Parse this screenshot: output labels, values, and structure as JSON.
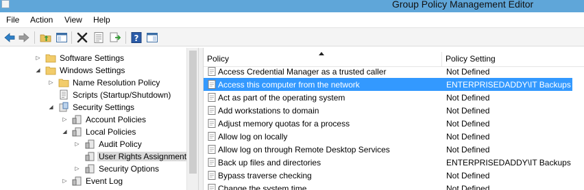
{
  "window": {
    "title": "Group Policy Management Editor"
  },
  "menu": {
    "file": "File",
    "action": "Action",
    "view": "View",
    "help": "Help"
  },
  "toolbar": {
    "icons": [
      "back-arrow-icon",
      "forward-arrow-icon",
      "up-folder-icon",
      "show-hide-tree-icon",
      "delete-icon",
      "properties-icon",
      "export-list-icon",
      "help-icon",
      "show-action-pane-icon"
    ]
  },
  "tree": {
    "items": [
      {
        "label": "Software Settings",
        "expander": "▷",
        "icon": "folder-icon"
      },
      {
        "label": "Windows Settings",
        "expander": "◢",
        "icon": "folder-icon"
      },
      {
        "label": "Name Resolution Policy",
        "expander": "▷",
        "icon": "folder-icon"
      },
      {
        "label": "Scripts (Startup/Shutdown)",
        "expander": "",
        "icon": "script-icon"
      },
      {
        "label": "Security Settings",
        "expander": "◢",
        "icon": "security-settings-icon"
      },
      {
        "label": "Account Policies",
        "expander": "▷",
        "icon": "policy-icon"
      },
      {
        "label": "Local Policies",
        "expander": "◢",
        "icon": "policy-icon"
      },
      {
        "label": "Audit Policy",
        "expander": "▷",
        "icon": "policy-icon"
      },
      {
        "label": "User Rights Assignment",
        "expander": "",
        "icon": "policy-icon"
      },
      {
        "label": "Security Options",
        "expander": "▷",
        "icon": "policy-icon"
      },
      {
        "label": "Event Log",
        "expander": "▷",
        "icon": "policy-icon"
      }
    ]
  },
  "list": {
    "columns": {
      "policy": "Policy",
      "setting": "Policy Setting"
    },
    "rows": [
      {
        "policy": "Access Credential Manager as a trusted caller",
        "setting": "Not Defined"
      },
      {
        "policy": "Access this computer from the network",
        "setting": "ENTERPRISEDADDY\\IT Backups"
      },
      {
        "policy": "Act as part of the operating system",
        "setting": "Not Defined"
      },
      {
        "policy": "Add workstations to domain",
        "setting": "Not Defined"
      },
      {
        "policy": "Adjust memory quotas for a process",
        "setting": "Not Defined"
      },
      {
        "policy": "Allow log on locally",
        "setting": "Not Defined"
      },
      {
        "policy": "Allow log on through Remote Desktop Services",
        "setting": "Not Defined"
      },
      {
        "policy": "Back up files and directories",
        "setting": "ENTERPRISEDADDY\\IT Backups"
      },
      {
        "policy": "Bypass traverse checking",
        "setting": "Not Defined"
      },
      {
        "policy": "Change the system time",
        "setting": "Not Defined"
      }
    ]
  },
  "colors": {
    "title_bar": "#5fa6d9",
    "selection": "#3399ff",
    "tree_selection": "#d9d9d9"
  }
}
